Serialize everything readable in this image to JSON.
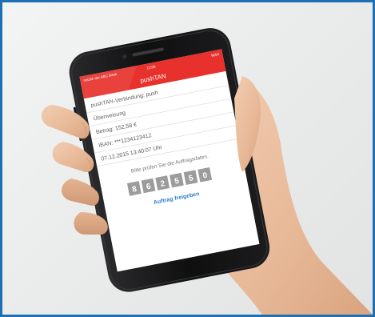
{
  "screen": {
    "status": {
      "carrier": "netzkk der ABC Bank",
      "time": "12:06",
      "right": "WAN"
    },
    "app_title": "pushTAN",
    "rows": [
      "pushTAN-Verbindung: push",
      "Überweisung",
      "Betrag: 152,58 €",
      "IBAN: ***1234123412",
      "07.12.2015 13:40:07 Uhr"
    ],
    "instruction": "Bitte prüfen Sie die Auftragsdaten.",
    "tan_digits": [
      "8",
      "6",
      "2",
      "5",
      "5",
      "0"
    ],
    "release_link": "Auftrag freigeben"
  },
  "colors": {
    "frame_border": "#1f6fb5",
    "app_header": "#e8312c",
    "link": "#2f7fc8",
    "tan_box": "#9c9c9c"
  },
  "icons": [
    "hand-photo",
    "smartphone"
  ]
}
